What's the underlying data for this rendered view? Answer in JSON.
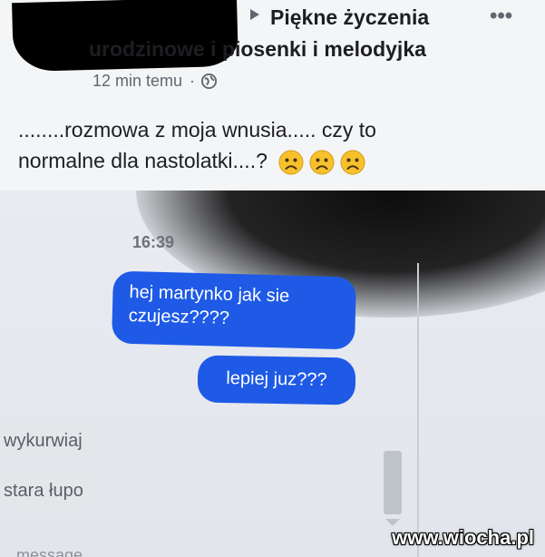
{
  "post": {
    "group_line1": "Piękne życzenia",
    "group_line2": "urodzinowe i piosenki i melodyjka",
    "time": "12 min temu",
    "separator": "·",
    "privacy_icon": "globe-icon",
    "more_icon": "•••",
    "text": "........rozmowa z moja wnusia..... czy to normalne dla nastolatki....?",
    "emojis": [
      "frowning-face-icon",
      "frowning-face-icon",
      "frowning-face-icon"
    ]
  },
  "chat": {
    "timestamp": "16:39",
    "sent": [
      "hej martynko jak sie czujesz????",
      "lepiej juz???"
    ],
    "received": [
      "wykurwiaj",
      "stara łupo"
    ],
    "compose_hint": "message"
  },
  "watermark": "www.wiocha.pl",
  "colors": {
    "sent_bubble": "#1e5ae6",
    "received_bubble": "#e4e6ea",
    "post_background": "#f4f5f7"
  }
}
